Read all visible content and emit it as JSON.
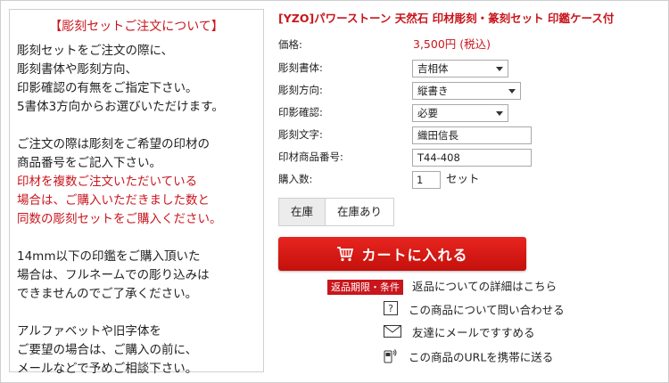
{
  "notice": {
    "heading": "【彫刻セットご注文について】",
    "lines": [
      "彫刻セットをご注文の際に、",
      "彫刻書体や彫刻方向、",
      "印影確認の有無をご指定下さい。",
      "5書体3方向からお選びいただけます。",
      "",
      "ご注文の際は彫刻をご希望の印材の",
      "商品番号をご記入下さい。",
      "印材を複数ご注文いただいている",
      "場合は、ご購入いただきました数と",
      "同数の彫刻セットをご購入ください。",
      "",
      "14mm以下の印鑑をご購入頂いた",
      "場合は、フルネームでの彫り込みは",
      "できませんのでご了承ください。",
      "",
      "アルファベットや旧字体を",
      "ご要望の場合は、ご購入の前に、",
      "メールなどで予めご相談下さい。"
    ]
  },
  "product": {
    "title": "[YZO]パワーストーン 天然石 印材彫刻・篆刻セット 印鑑ケース付",
    "price_label": "価格:",
    "price_value": "3,500円 (税込)",
    "font_label": "彫刻書体:",
    "font_value": "吉相体",
    "direction_label": "彫刻方向:",
    "direction_value": "縦書き",
    "proof_label": "印影確認:",
    "proof_value": "必要",
    "text_label": "彫刻文字:",
    "text_value": "織田信長",
    "item_no_label": "印材商品番号:",
    "item_no_value": "T44-408",
    "qty_label": "購入数:",
    "qty_value": "1",
    "qty_unit": "セット"
  },
  "stock": {
    "label": "在庫",
    "value": "在庫あり"
  },
  "cart_button": "カートに入れる",
  "links": {
    "return_badge": "返品期限・条件",
    "return_text": "返品についての詳細はこちら",
    "inquiry_text": "この商品について問い合わせる",
    "mail_text": "友達にメールですすめる",
    "mobile_text": "この商品のURLを携帯に送る"
  }
}
